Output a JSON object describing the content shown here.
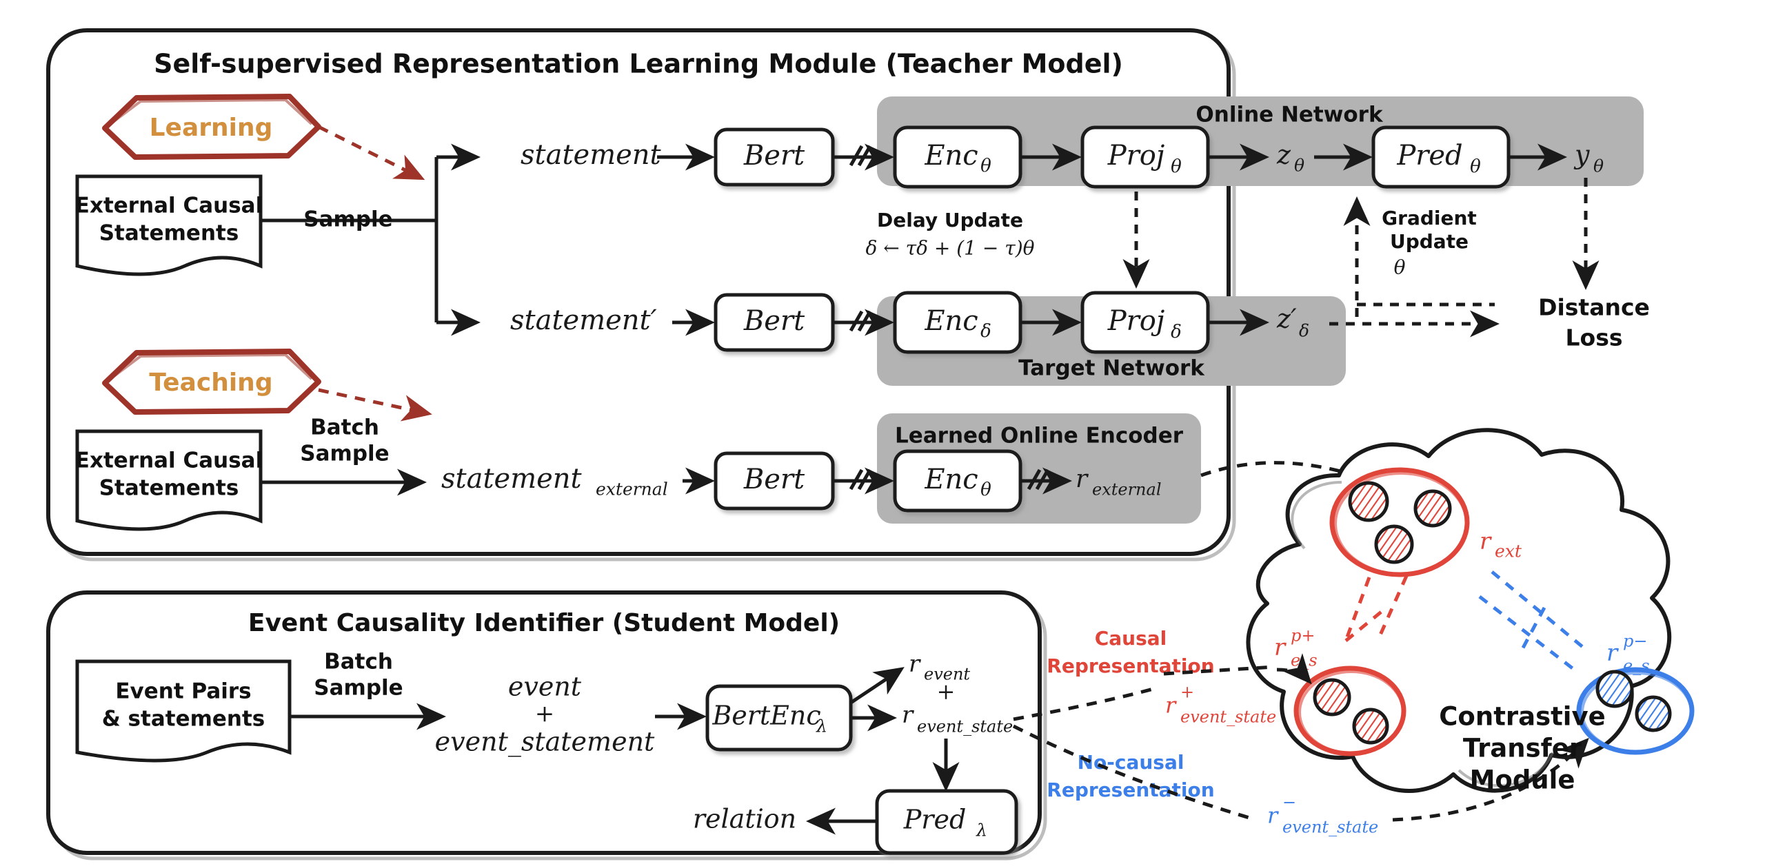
{
  "figure": {
    "type": "architecture-diagram",
    "background": "#ffffff",
    "colors": {
      "hexagon_border": "#9e3429",
      "hexagon_text": "#d2903f",
      "gray_panel": "#b3b3b3",
      "causal_red": "#e0453a",
      "nocausal_blue": "#3d7fe8",
      "outline": "#1a1a1a"
    }
  },
  "teacher_panel": {
    "title": "Self-supervised Representation Learning Module (Teacher Model)",
    "hexagons": [
      {
        "label": "Learning"
      },
      {
        "label": "Teaching"
      }
    ],
    "docs": [
      {
        "line1": "External Causal",
        "line2": "Statements"
      },
      {
        "line1": "External Causal",
        "line2": "Statements"
      }
    ],
    "edge_labels": {
      "sample": "Sample",
      "batch": "Batch",
      "batch_sample": "Sample"
    },
    "online_network": {
      "label": "Online Network",
      "nodes": [
        "Enc",
        "Proj",
        "Pred"
      ],
      "subs": [
        "θ",
        "θ",
        "θ"
      ],
      "input": "statement",
      "bert": "Bert",
      "z": "z",
      "z_sub": "θ",
      "y": "y",
      "y_sub": "θ"
    },
    "target_network": {
      "label": "Target Network",
      "nodes": [
        "Enc",
        "Proj"
      ],
      "subs": [
        "δ",
        "δ"
      ],
      "input": "statement′",
      "bert": "Bert",
      "z": "z′",
      "z_sub": "δ"
    },
    "learned_encoder": {
      "label": "Learned Online Encoder",
      "input": "statement",
      "input_sub": "external",
      "bert": "Bert",
      "node": "Enc",
      "node_sub": "θ",
      "output": "r",
      "output_sub": "external"
    },
    "delay_update": {
      "line1": "Delay Update",
      "formula": "δ ← τδ + (1 − τ)θ"
    },
    "gradient_update": {
      "line1": "Gradient",
      "line2": "Update",
      "symbol": "θ"
    },
    "distance_loss": {
      "line1": "Distance",
      "line2": "Loss"
    },
    "stopgrad_marker": "//"
  },
  "student_panel": {
    "title": "Event Causality Identifier (Student Model)",
    "doc": {
      "line1": "Event Pairs",
      "line2": "& statements"
    },
    "edge_labels": {
      "batch": "Batch",
      "sample": "Sample"
    },
    "input": {
      "line1": "event",
      "plus": "+",
      "line2": "event_statement"
    },
    "encoder": {
      "name": "BertEnc",
      "sub": "λ"
    },
    "outputs": {
      "r_event": "r",
      "r_event_sub": "event",
      "plus": "+",
      "r_event_state": "r",
      "r_event_state_sub": "event_state"
    },
    "predictor": {
      "name": "Pred",
      "sub": "λ"
    },
    "relation": "relation"
  },
  "contrastive_module": {
    "title_lines": [
      "Contrastive",
      "Transfer",
      "Module"
    ],
    "legend": {
      "causal": {
        "line1": "Causal",
        "line2": "Representation"
      },
      "nocausal": {
        "line1": "No-causal",
        "line2": "Representation"
      }
    },
    "clusters": [
      {
        "id": "r_ext",
        "base": "r",
        "sub": "ext",
        "sup": "",
        "color": "#e0453a",
        "dots": 3
      },
      {
        "id": "r_e_s_pos",
        "base": "r",
        "sub": "e_s",
        "sup": "p+",
        "color": "#e0453a",
        "dots": 2
      },
      {
        "id": "r_e_s_neg",
        "base": "r",
        "sub": "e_s",
        "sup": "p−",
        "color": "#3d7fe8",
        "dots": 2
      }
    ],
    "flow_labels": {
      "pos": {
        "base": "r",
        "sub": "event_state",
        "sup": "+",
        "color": "#e0453a"
      },
      "neg": {
        "base": "r",
        "sub": "event_state",
        "sup": "−",
        "color": "#3d7fe8"
      }
    }
  }
}
